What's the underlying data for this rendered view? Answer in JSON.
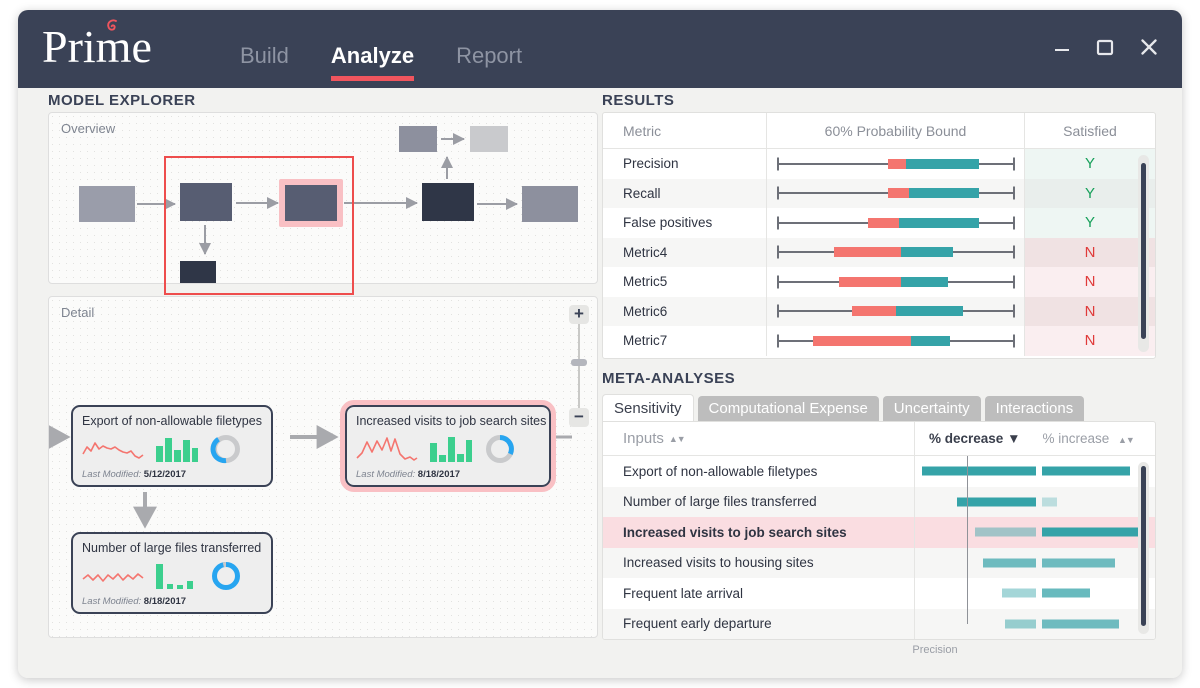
{
  "window": {
    "brand": "Prime",
    "controls": {
      "minimize": "minimize-icon",
      "maximize": "maximize-icon",
      "close": "close-icon"
    }
  },
  "nav": {
    "items": [
      {
        "label": "Build",
        "active": false
      },
      {
        "label": "Analyze",
        "active": true
      },
      {
        "label": "Report",
        "active": false
      }
    ]
  },
  "model_explorer": {
    "title": "MODEL EXPLORER",
    "overview_label": "Overview",
    "detail_label": "Detail",
    "zoom": {
      "plus": "+",
      "minus": "−"
    },
    "cards": [
      {
        "title": "Export of non-allowable filetypes",
        "modified_label": "Last Modified:",
        "modified_value": "5/12/2017",
        "highlight": false,
        "sparkline": [
          13,
          26,
          17,
          31,
          22,
          27,
          24,
          22,
          25,
          21,
          18,
          16,
          19,
          12,
          9,
          14
        ],
        "bars": [
          62,
          100,
          48,
          86,
          55
        ],
        "gauge_pct": 62
      },
      {
        "title": "Increased visits to job search sites",
        "modified_label": "Last Modified:",
        "modified_value": "8/18/2017",
        "highlight": true,
        "sparkline": [
          10,
          16,
          42,
          20,
          50,
          28,
          66,
          30,
          72,
          20,
          10,
          16,
          12,
          8
        ],
        "bars": [
          70,
          28,
          100,
          30,
          88
        ],
        "gauge_pct": 22
      },
      {
        "title": "Number of large files transferred",
        "modified_label": "Last Modified:",
        "modified_value": "8/18/2017",
        "highlight": false,
        "sparkline": [
          20,
          30,
          16,
          28,
          14,
          30,
          18,
          32,
          16,
          30,
          20,
          34,
          22,
          30
        ],
        "bars": [
          100,
          18,
          14,
          30,
          38
        ],
        "gauge_pct": 96
      }
    ]
  },
  "results": {
    "title": "RESULTS",
    "columns": [
      "Metric",
      "60% Probability Bound",
      "Satisfied"
    ],
    "rows": [
      {
        "metric": "Precision",
        "satisfied": "Y",
        "low": 4,
        "red_start": 47,
        "teal_start": 54,
        "high_end": 82,
        "whisker_end": 96
      },
      {
        "metric": "Recall",
        "satisfied": "Y",
        "low": 4,
        "red_start": 47,
        "teal_start": 55,
        "high_end": 82,
        "whisker_end": 96
      },
      {
        "metric": "False positives",
        "satisfied": "Y",
        "low": 4,
        "red_start": 39,
        "teal_start": 51,
        "high_end": 82,
        "whisker_end": 96
      },
      {
        "metric": "Metric4",
        "satisfied": "N",
        "low": 4,
        "red_start": 26,
        "teal_start": 52,
        "high_end": 72,
        "whisker_end": 96
      },
      {
        "metric": "Metric5",
        "satisfied": "N",
        "low": 4,
        "red_start": 28,
        "teal_start": 52,
        "high_end": 70,
        "whisker_end": 96
      },
      {
        "metric": "Metric6",
        "satisfied": "N",
        "low": 4,
        "red_start": 33,
        "teal_start": 50,
        "high_end": 76,
        "whisker_end": 96
      },
      {
        "metric": "Metric7",
        "satisfied": "N",
        "low": 4,
        "red_start": 18,
        "teal_start": 56,
        "high_end": 71,
        "whisker_end": 96
      }
    ]
  },
  "meta": {
    "title": "META-ANALYSES",
    "tabs": [
      {
        "label": "Sensitivity",
        "active": true
      },
      {
        "label": "Computational Expense",
        "active": false
      },
      {
        "label": "Uncertainty",
        "active": false
      },
      {
        "label": "Interactions",
        "active": false
      }
    ],
    "inputs_header": "Inputs",
    "decrease_header": "% decrease",
    "increase_header": "% increase",
    "axis_label": "Precision",
    "rows": [
      {
        "label": "Export of non-allowable filetypes",
        "decrease": 97,
        "increase": 83,
        "selected": false,
        "dec_alpha": 1.0,
        "inc_alpha": 1.0
      },
      {
        "label": "Number of large files transferred",
        "decrease": 67,
        "increase": 14,
        "selected": false,
        "dec_alpha": 1.0,
        "inc_alpha": 0.3
      },
      {
        "label": "Increased visits to job search sites",
        "decrease": 52,
        "increase": 93,
        "selected": true,
        "dec_alpha": 0.45,
        "inc_alpha": 1.0
      },
      {
        "label": "Increased visits to housing sites",
        "decrease": 45,
        "increase": 69,
        "selected": false,
        "dec_alpha": 0.7,
        "inc_alpha": 0.7
      },
      {
        "label": "Frequent late arrival",
        "decrease": 29,
        "increase": 45,
        "selected": false,
        "dec_alpha": 0.45,
        "inc_alpha": 0.75
      },
      {
        "label": "Frequent early departure",
        "decrease": 26,
        "increase": 73,
        "selected": false,
        "dec_alpha": 0.5,
        "inc_alpha": 0.7
      }
    ]
  },
  "colors": {
    "navy": "#3a4256",
    "accent_red": "#f0555e",
    "teal": "#35a3a8",
    "coral": "#f4756f",
    "green_yes": "#17a05a",
    "red_no": "#e03a3a",
    "pink_highlight": "#fadde1",
    "sparkline_red": "#f4756f",
    "bar_green": "#3ccf8e",
    "gauge_blue": "#27a5f0"
  }
}
